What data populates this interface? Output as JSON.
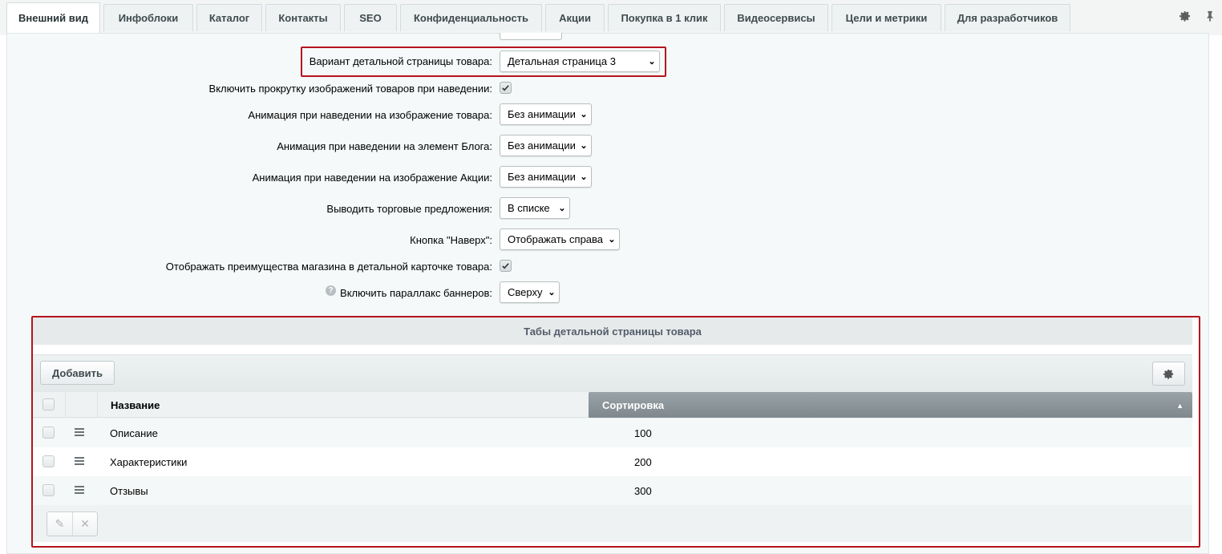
{
  "tabs": [
    {
      "label": "Внешний вид"
    },
    {
      "label": "Инфоблоки"
    },
    {
      "label": "Каталог"
    },
    {
      "label": "Контакты"
    },
    {
      "label": "SEO"
    },
    {
      "label": "Конфиденциальность"
    },
    {
      "label": "Акции"
    },
    {
      "label": "Покупка в 1 клик"
    },
    {
      "label": "Видеосервисы"
    },
    {
      "label": "Цели и метрики"
    },
    {
      "label": "Для разработчиков"
    }
  ],
  "icons": {
    "settings": "gear-icon",
    "pin": "pin-icon",
    "help": "help-icon"
  },
  "settings": {
    "detail_page": {
      "label": "Вариант детальной страницы товара:",
      "value": "Детальная страница 3"
    },
    "image_scroll": {
      "label": "Включить прокрутку изображений товаров при наведении:",
      "checked": true
    },
    "anim_product": {
      "label": "Анимация при наведении на изображение товара:",
      "value": "Без анимации"
    },
    "anim_blog": {
      "label": "Анимация при наведении на элемент Блога:",
      "value": "Без анимации"
    },
    "anim_sale": {
      "label": "Анимация при наведении на изображение Акции:",
      "value": "Без анимации"
    },
    "offers": {
      "label": "Выводить торговые предложения:",
      "value": "В списке"
    },
    "up_button": {
      "label": "Кнопка \"Наверх\":",
      "value": "Отображать справа"
    },
    "advantages": {
      "label": "Отображать преимущества магазина в детальной карточке товара:",
      "checked": true
    },
    "parallax": {
      "label": "Включить параллакс баннеров:",
      "value": "Сверху"
    }
  },
  "tabs_section": {
    "title": "Табы детальной страницы товара",
    "add_button": "Добавить",
    "columns": {
      "name": "Название",
      "sort": "Сортировка"
    },
    "rows": [
      {
        "name": "Описание",
        "sort": "100"
      },
      {
        "name": "Характеристики",
        "sort": "200"
      },
      {
        "name": "Отзывы",
        "sort": "300"
      }
    ]
  },
  "colors": {
    "highlight": "#b4141d",
    "header_sorted": "#8a9397"
  }
}
